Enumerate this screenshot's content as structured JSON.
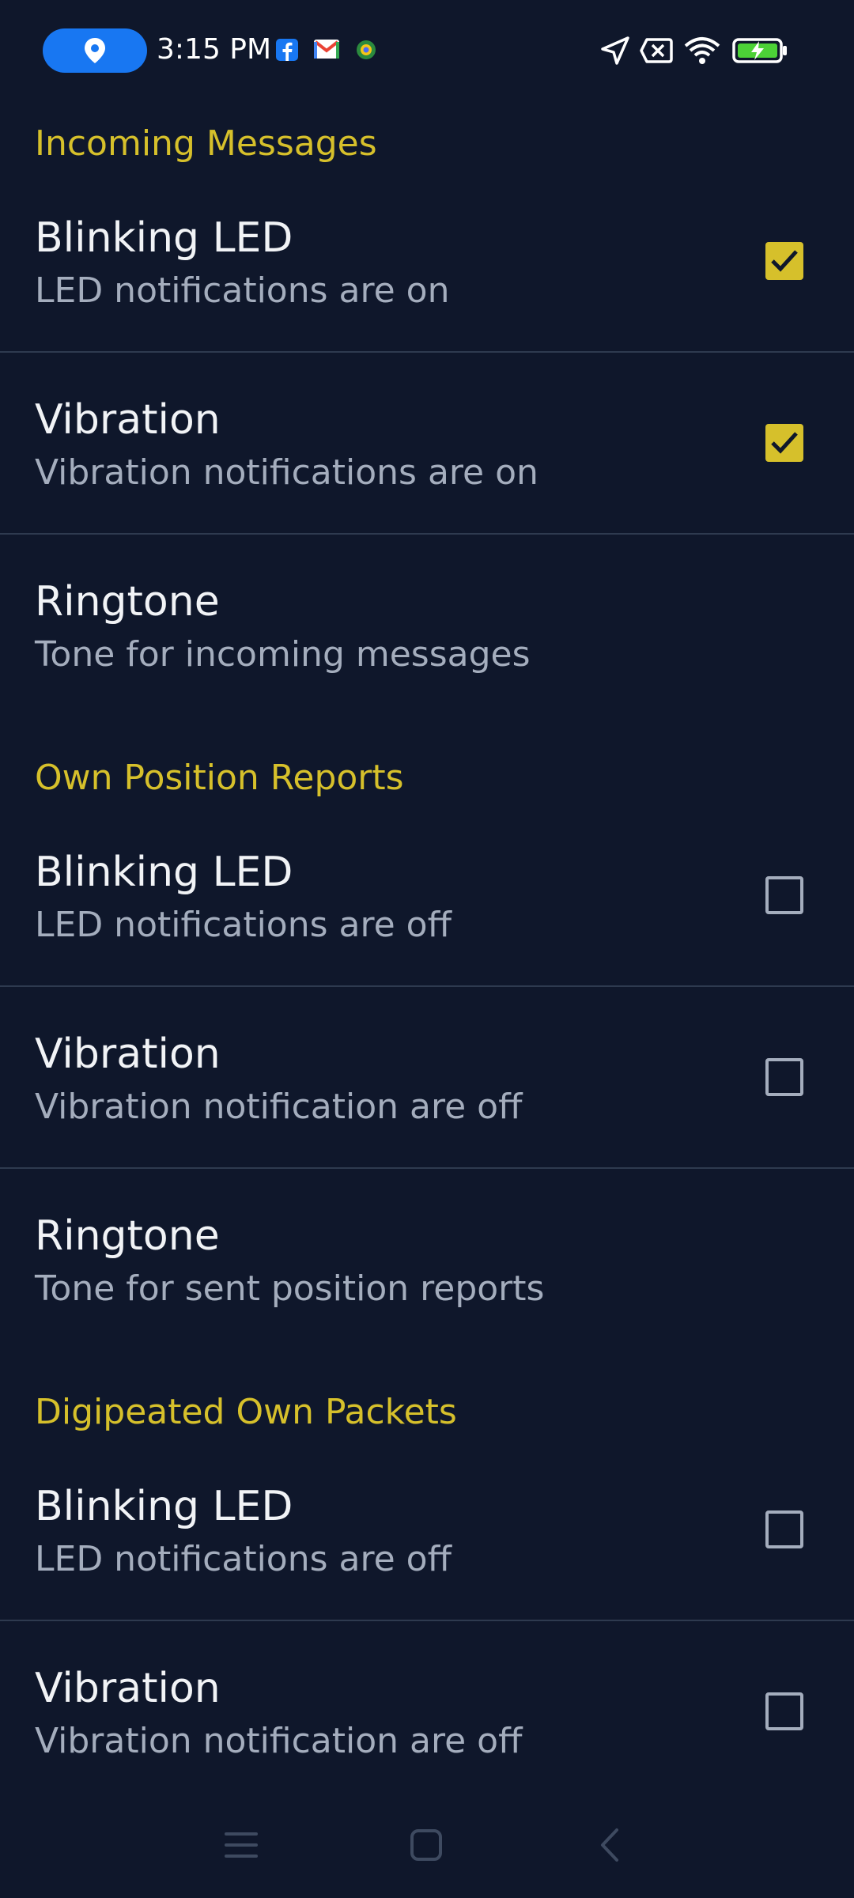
{
  "status_bar": {
    "time": "3:15 PM",
    "left_icons": [
      "location-pin-icon",
      "facebook-icon",
      "gmail-icon",
      "app-notification-icon"
    ],
    "right_icons": [
      "navigation-arrow-icon",
      "no-sim-icon",
      "wifi-icon",
      "battery-charging-icon"
    ]
  },
  "sections": [
    {
      "header": "Incoming Messages",
      "items": [
        {
          "title": "Blinking LED",
          "summary": "LED notifications are on",
          "checked": true
        },
        {
          "title": "Vibration",
          "summary": "Vibration notifications are on",
          "checked": true
        },
        {
          "title": "Ringtone",
          "summary": "Tone for incoming messages"
        }
      ]
    },
    {
      "header": "Own Position Reports",
      "items": [
        {
          "title": "Blinking LED",
          "summary": "LED notifications are off",
          "checked": false
        },
        {
          "title": "Vibration",
          "summary": "Vibration notification are off",
          "checked": false
        },
        {
          "title": "Ringtone",
          "summary": "Tone for sent position reports"
        }
      ]
    },
    {
      "header": "Digipeated Own Packets",
      "items": [
        {
          "title": "Blinking LED",
          "summary": "LED notifications are off",
          "checked": false
        },
        {
          "title": "Vibration",
          "summary": "Vibration notification are off",
          "checked": false
        }
      ]
    }
  ],
  "nav_bar": {
    "buttons": [
      "menu-icon",
      "home-icon",
      "back-icon"
    ]
  },
  "colors": {
    "background": "#0f172b",
    "accent": "#d6c02b",
    "title_text": "#f1f3f6",
    "summary_text": "#a4adbd",
    "divider": "#2e3a4f"
  }
}
